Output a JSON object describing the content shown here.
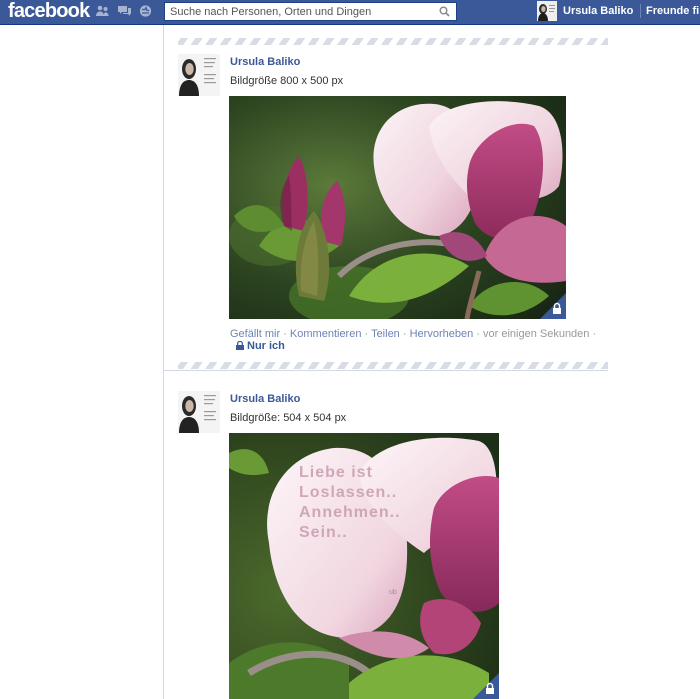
{
  "topbar": {
    "logo": "facebook",
    "search_placeholder": "Suche nach Personen, Orten und Dingen",
    "user_name": "Ursula Baliko",
    "friends_link": "Freunde fi",
    "jewels": [
      "friend-requests-icon",
      "messages-icon",
      "notifications-icon"
    ]
  },
  "posts": [
    {
      "author": "Ursula Baliko",
      "text": "Bildgröße 800 x 500 px",
      "image": "magnolia-flower-photo",
      "actions": [
        "Gefällt mir",
        "Kommentieren",
        "Teilen",
        "Hervorheben"
      ],
      "time": "vor einigen Sekunden",
      "privacy": "Nur ich"
    },
    {
      "author": "Ursula Baliko",
      "text": "Bildgröße: 504 x 504 px",
      "image": "magnolia-flower-photo-with-text",
      "overlay_lines": [
        "Liebe ist",
        "Loslassen..",
        "Annehmen..",
        "Sein.."
      ],
      "watermark": "ub"
    }
  ],
  "colors": {
    "brand_blue": "#3b5998",
    "link_blue": "#6d84b4",
    "magnolia_pink": "#b04a7c"
  }
}
